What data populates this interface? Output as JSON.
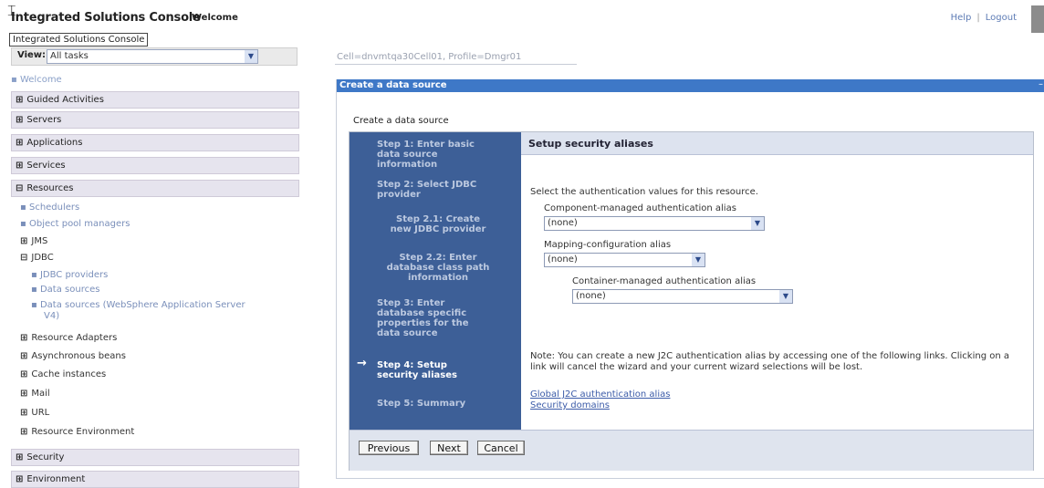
{
  "banner": {
    "app_title": "Integrated Solutions Console",
    "welcome": "Welcome",
    "help": "Help",
    "separator": "|",
    "logout": "Logout",
    "tooltip": "Integrated Solutions Console"
  },
  "nav": {
    "view_label": "View:",
    "view_value": "All tasks",
    "welcome_link": "Welcome",
    "sections": [
      {
        "label": "Guided Activities",
        "expanded": false
      },
      {
        "label": "Servers",
        "expanded": false
      },
      {
        "label": "Applications",
        "expanded": false
      },
      {
        "label": "Services",
        "expanded": false
      },
      {
        "label": "Resources",
        "expanded": true
      },
      {
        "label": "Security",
        "expanded": false
      },
      {
        "label": "Environment",
        "expanded": false
      }
    ],
    "resources_items": {
      "schedulers": "Schedulers",
      "object_pool_managers": "Object pool managers",
      "jms": "JMS",
      "jdbc": "JDBC",
      "jdbc_providers": "JDBC providers",
      "data_sources": "Data sources",
      "data_sources_was_line1": "Data sources (WebSphere Application Server",
      "data_sources_was_line2": "V4)",
      "resource_adapters": "Resource Adapters",
      "asynchronous_beans": "Asynchronous beans",
      "cache_instances": "Cache instances",
      "mail": "Mail",
      "url": "URL",
      "resource_environment": "Resource Environment"
    },
    "expand_symbol": "⊞",
    "collapse_symbol": "⊟",
    "bullet": "▪"
  },
  "main": {
    "cell_info": "Cell=dnvmtqa30Cell01, Profile=Dmgr01",
    "panel_title": "Create a data source",
    "panel_min": "–",
    "section_title": "Create a data source",
    "steps": [
      {
        "lines": [
          "Step 1: Enter basic",
          "data source",
          "information"
        ],
        "current": false
      },
      {
        "lines": [
          "Step 2: Select JDBC",
          "provider"
        ],
        "current": false
      },
      {
        "lines": [
          "Step 2.1: Create",
          "new JDBC provider"
        ],
        "current": false
      },
      {
        "lines": [
          "Step 2.2: Enter",
          "database class path",
          "information"
        ],
        "current": false
      },
      {
        "lines": [
          "Step 3: Enter",
          "database specific",
          "properties for the",
          "data source"
        ],
        "current": false
      },
      {
        "lines": [
          "Step 4: Setup",
          "security aliases"
        ],
        "current": true
      },
      {
        "lines": [
          "Step 5: Summary"
        ],
        "current": false
      }
    ],
    "current_arrow": "→",
    "content": {
      "title": "Setup security aliases",
      "intro": "Select the authentication values for this resource.",
      "component_label": "Component-managed authentication alias",
      "component_value": "(none)",
      "mapping_label": "Mapping-configuration alias",
      "mapping_value": "(none)",
      "container_label": "Container-managed authentication alias",
      "container_value": "(none)",
      "note": "Note: You can create a new J2C authentication alias by accessing one of the following links. Clicking on a link will cancel the wizard and your current wizard selections will be lost.",
      "link_global": "Global J2C authentication alias",
      "link_domains": "Security domains"
    },
    "buttons": {
      "previous": "Previous",
      "next": "Next",
      "cancel": "Cancel"
    }
  },
  "colors": {
    "panel_header": "#3e78c7",
    "wizard_steps_bg": "#3d5f97",
    "link": "#3b5ba8"
  }
}
